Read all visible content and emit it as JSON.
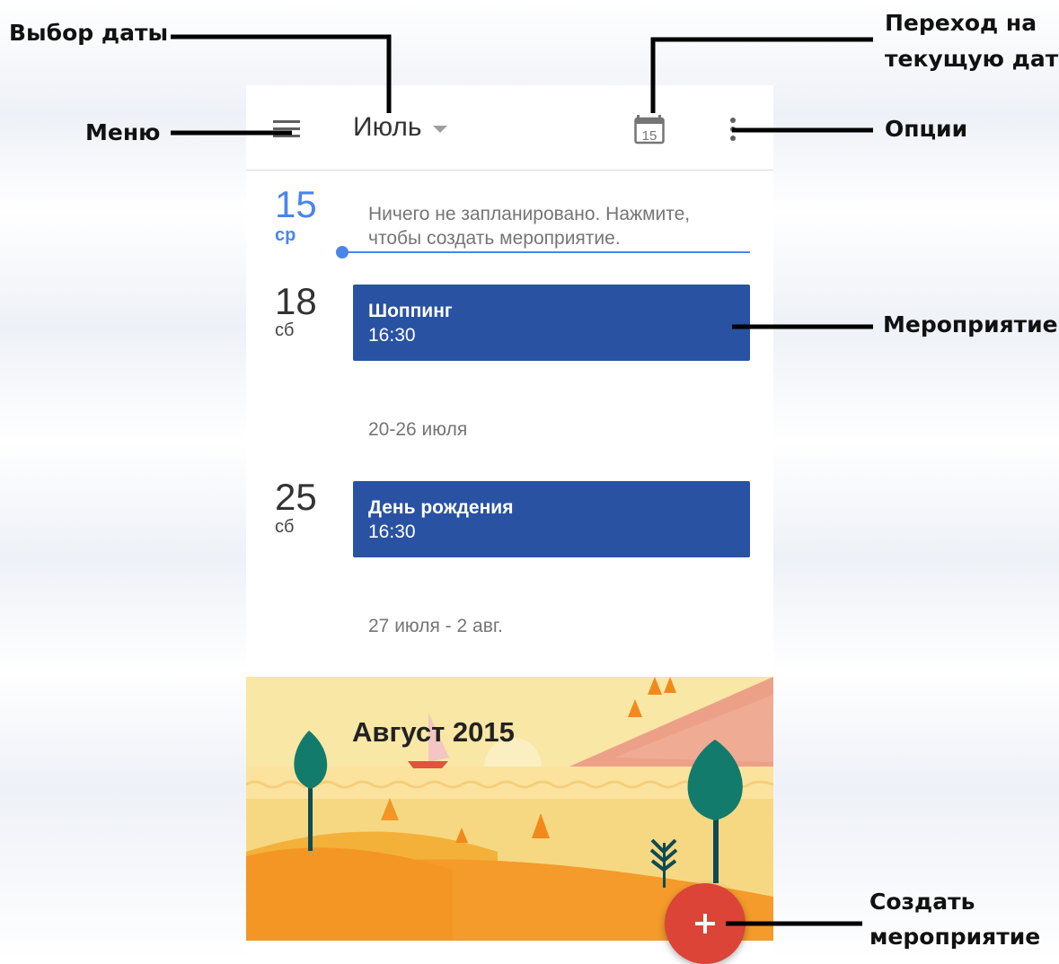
{
  "annotations": {
    "date_picker": "Выбор даты",
    "go_today_line1": "Переход на",
    "go_today_line2": "текущую дату",
    "menu": "Меню",
    "options": "Опции",
    "event": "Мероприятие",
    "create_line1": "Создать",
    "create_line2": "мероприятие"
  },
  "toolbar": {
    "month": "Июль",
    "today_icon_day": "15",
    "menu_icon": "hamburger-icon",
    "today_icon": "calendar-today-icon",
    "options_icon": "more-vert-icon"
  },
  "agenda": {
    "today": {
      "day": "15",
      "weekday": "ср",
      "empty_text": "Ничего не запланировано. Нажмите, чтобы создать мероприятие."
    },
    "days": [
      {
        "day": "18",
        "weekday": "сб",
        "event_title": "Шоппинг",
        "event_time": "16:30"
      },
      {
        "day": "25",
        "weekday": "сб",
        "event_title": "День рождения",
        "event_time": "16:30"
      }
    ],
    "weeks": [
      "20-26 июля",
      "27 июля - 2 авг."
    ]
  },
  "month_banner": {
    "title": "Август 2015"
  },
  "colors": {
    "accent": "#4a86e8",
    "event": "#2952a3",
    "fab": "#db4437"
  }
}
